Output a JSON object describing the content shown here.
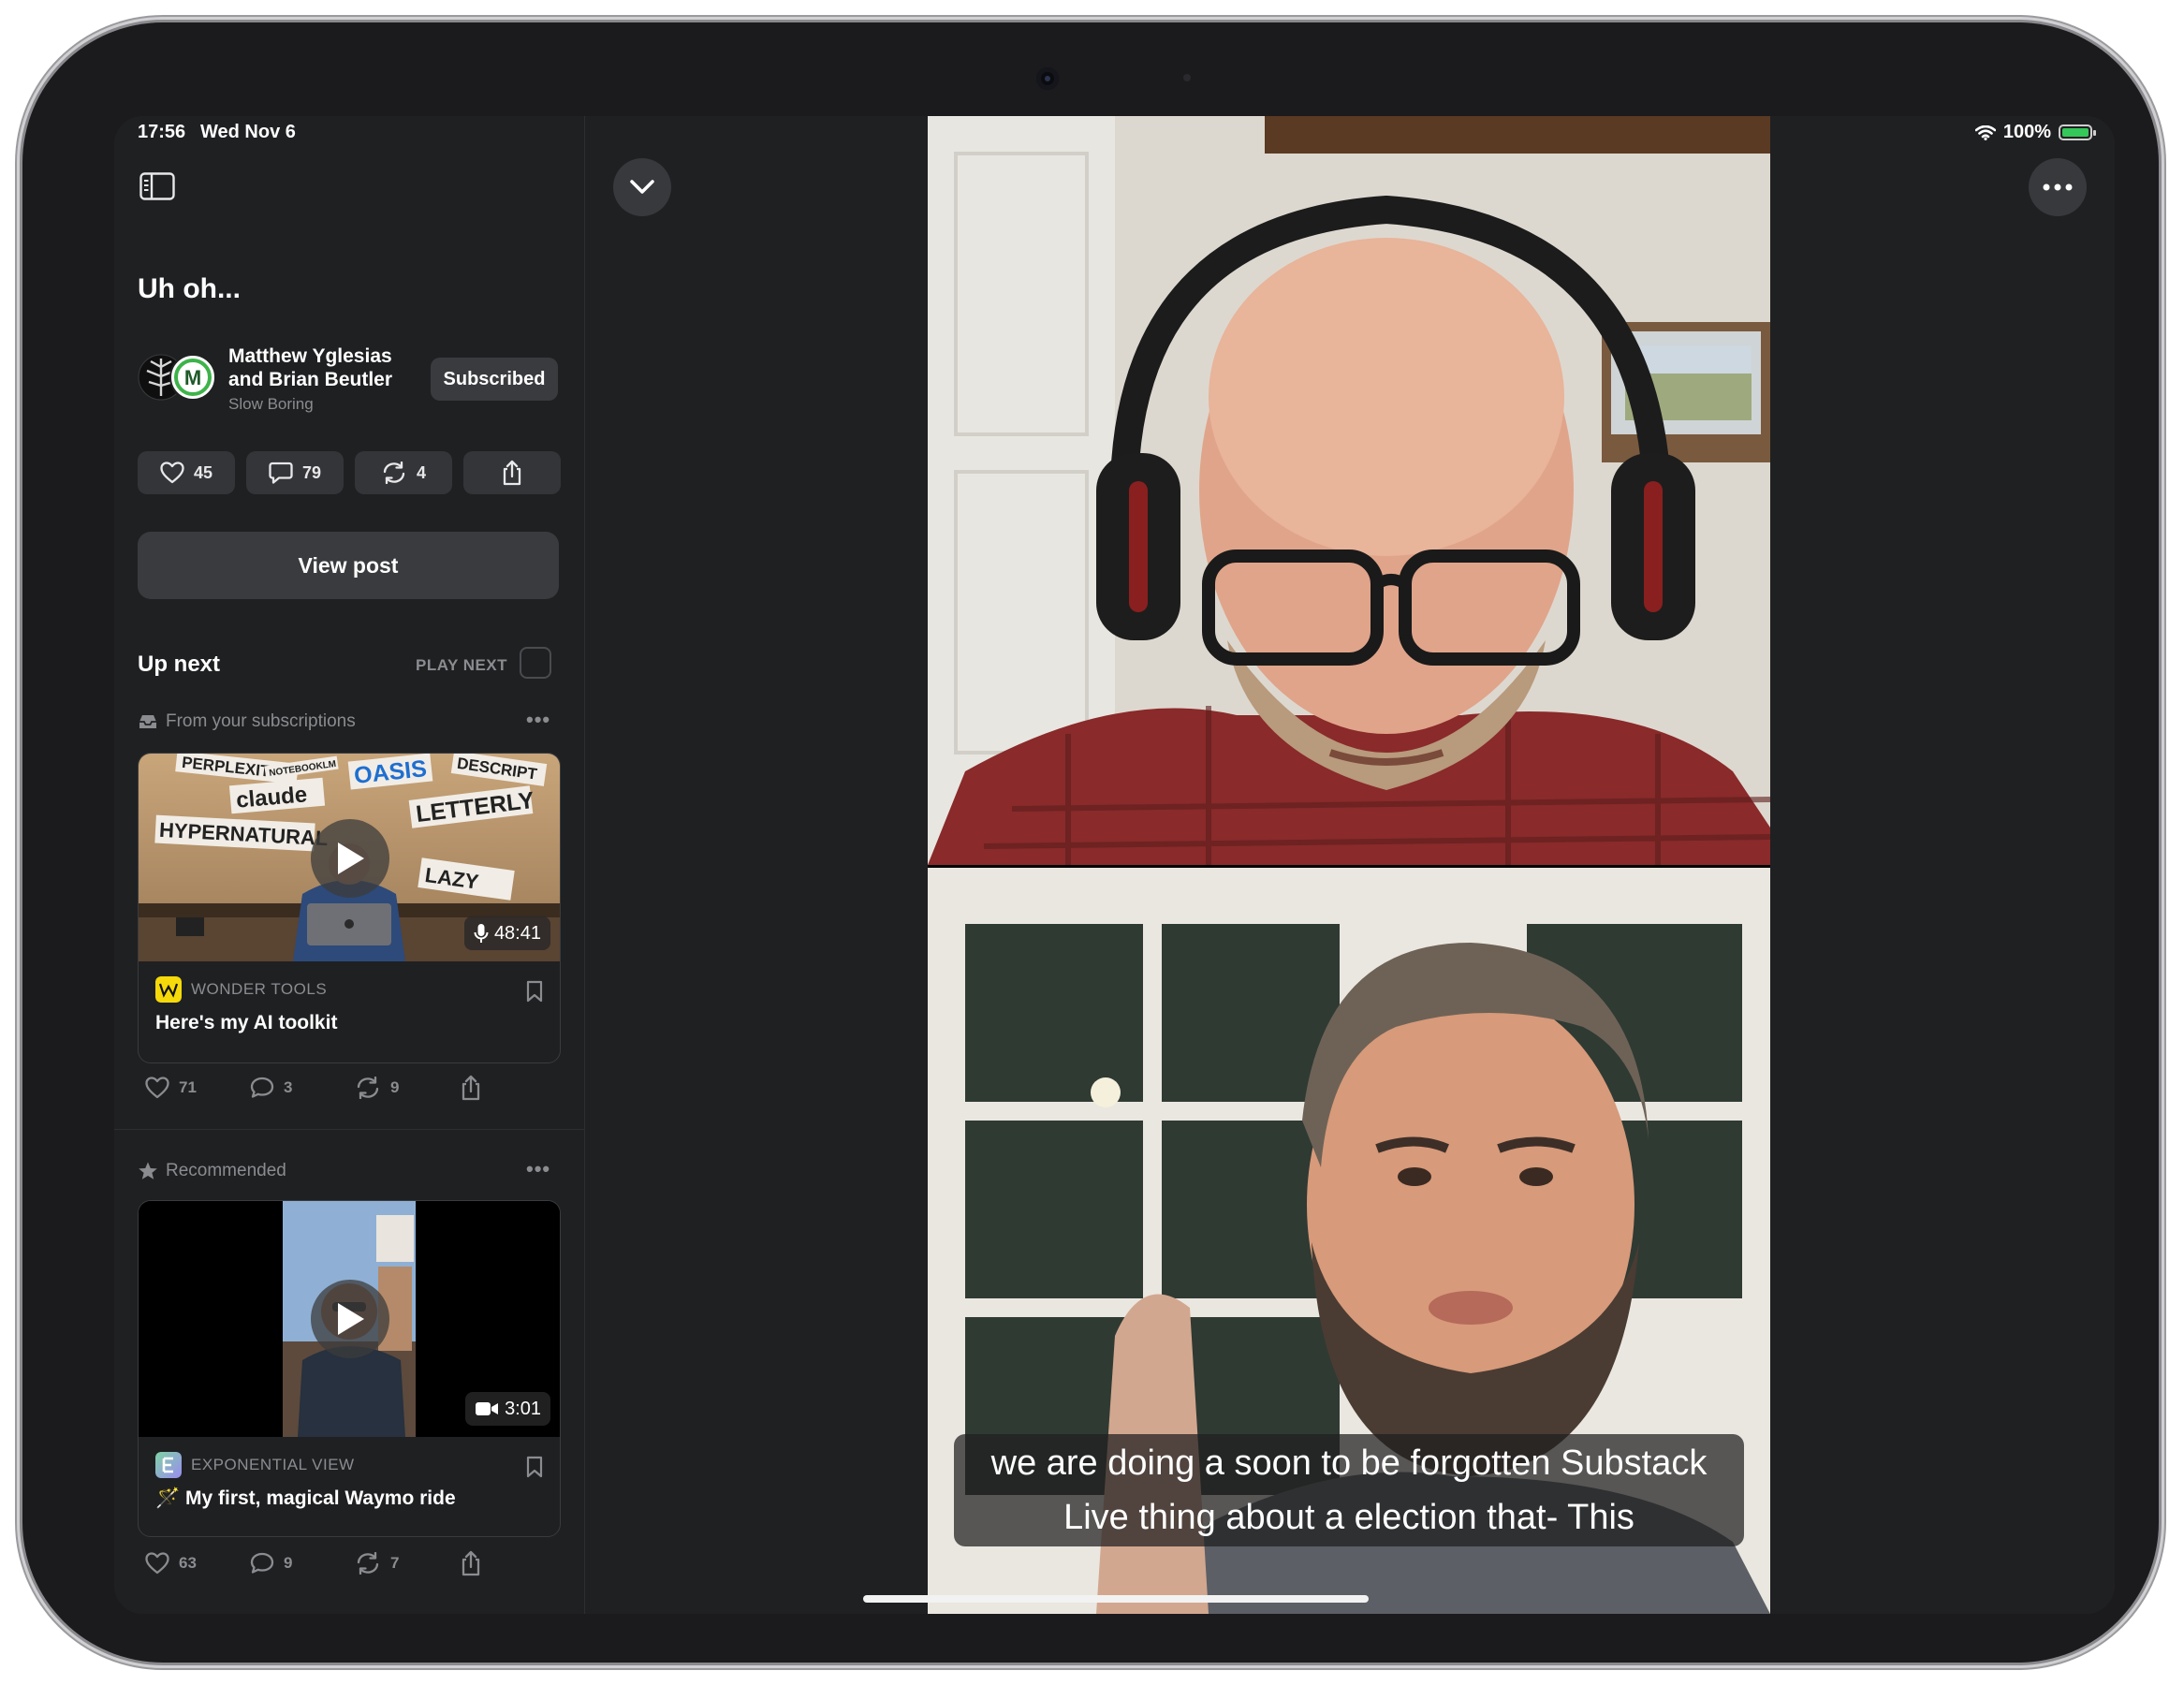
{
  "status_bar": {
    "time": "17:56",
    "date": "Wed Nov 6",
    "battery": "100%"
  },
  "post": {
    "title": "Uh oh...",
    "authors": "Matthew Yglesias and Brian Beutler",
    "publication": "Slow Boring",
    "subscribe_label": "Subscribed",
    "likes": "45",
    "comments": "79",
    "restacks": "4",
    "view_post_label": "View post"
  },
  "up_next": {
    "heading": "Up next",
    "play_next_label": "PLAY NEXT",
    "sections": [
      {
        "label": "From your subscriptions",
        "item": {
          "duration": "48:41",
          "publication": "WONDER TOOLS",
          "title": "Here's my AI toolkit",
          "likes": "71",
          "comments": "3",
          "restacks": "9",
          "thumb_words": [
            "PERPLEXITY",
            "NOTEBOOKLM",
            "claude",
            "OASIS",
            "DESCRIPT",
            "LETTERLY",
            "HYPERNATURAL",
            "LAZY"
          ]
        }
      },
      {
        "label": "Recommended",
        "item": {
          "duration": "3:01",
          "publication": "EXPONENTIAL VIEW",
          "title": "My first, magical Waymo ride",
          "title_prefix": "🪄",
          "likes": "63",
          "comments": "9",
          "restacks": "7"
        }
      }
    ]
  },
  "video": {
    "caption_line1": "we are doing a soon to be forgotten Substack",
    "caption_line2": "Live thing about a election that- This"
  },
  "colors": {
    "background": "#1f2022",
    "card": "#343538",
    "text": "#ffffff",
    "muted": "#8b8c90",
    "battery": "#34c759"
  }
}
